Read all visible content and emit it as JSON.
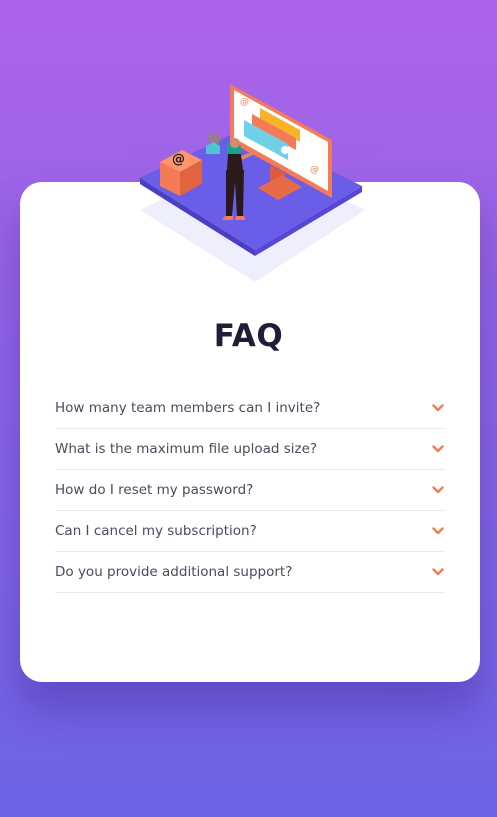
{
  "page": {
    "title": "FAQ"
  },
  "faq": {
    "items": [
      {
        "question": "How many team members can I invite?",
        "icon": "chevron-down-icon"
      },
      {
        "question": "What is the maximum file upload size?",
        "icon": "chevron-down-icon"
      },
      {
        "question": "How do I reset my password?",
        "icon": "chevron-down-icon"
      },
      {
        "question": "Can I cancel my subscription?",
        "icon": "chevron-down-icon"
      },
      {
        "question": "Do you provide additional support?",
        "icon": "chevron-down-icon"
      }
    ]
  },
  "colors": {
    "background_top": "#ad63e9",
    "background_bottom": "#6b63e4",
    "accent": "#f47b56",
    "title": "#1e1f36",
    "question_text": "#4a4b5e",
    "divider": "#e8e8ea"
  }
}
